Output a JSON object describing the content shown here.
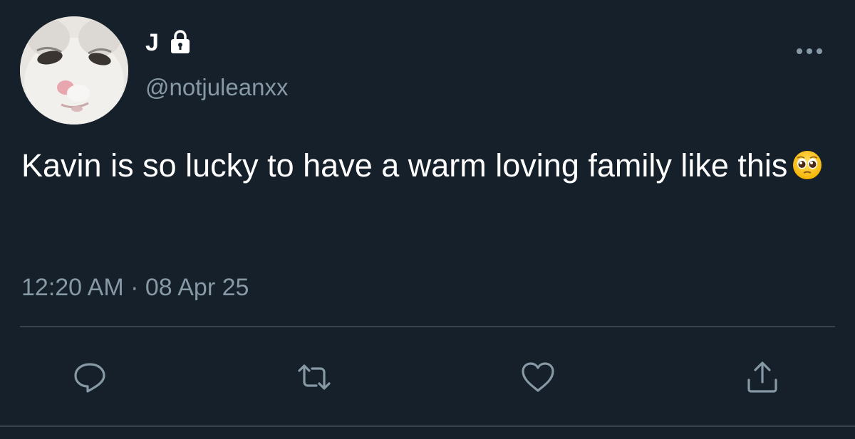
{
  "tweet": {
    "display_name": "J",
    "handle": "@notjuleanxx",
    "text": "Kavin is so lucky to have a warm loving family like this",
    "emoji": "pleading-face-emoji",
    "timestamp": "12:20 AM · 08 Apr 25",
    "protected": true
  },
  "icons": {
    "lock": "lock-icon",
    "more": "more-options-icon",
    "reply": "reply-icon",
    "retweet": "retweet-icon",
    "like": "like-icon",
    "share": "share-icon"
  },
  "colors": {
    "background": "#15202b",
    "primary_text": "#ffffff",
    "secondary_text": "#8899a6",
    "divider": "#38444d"
  }
}
